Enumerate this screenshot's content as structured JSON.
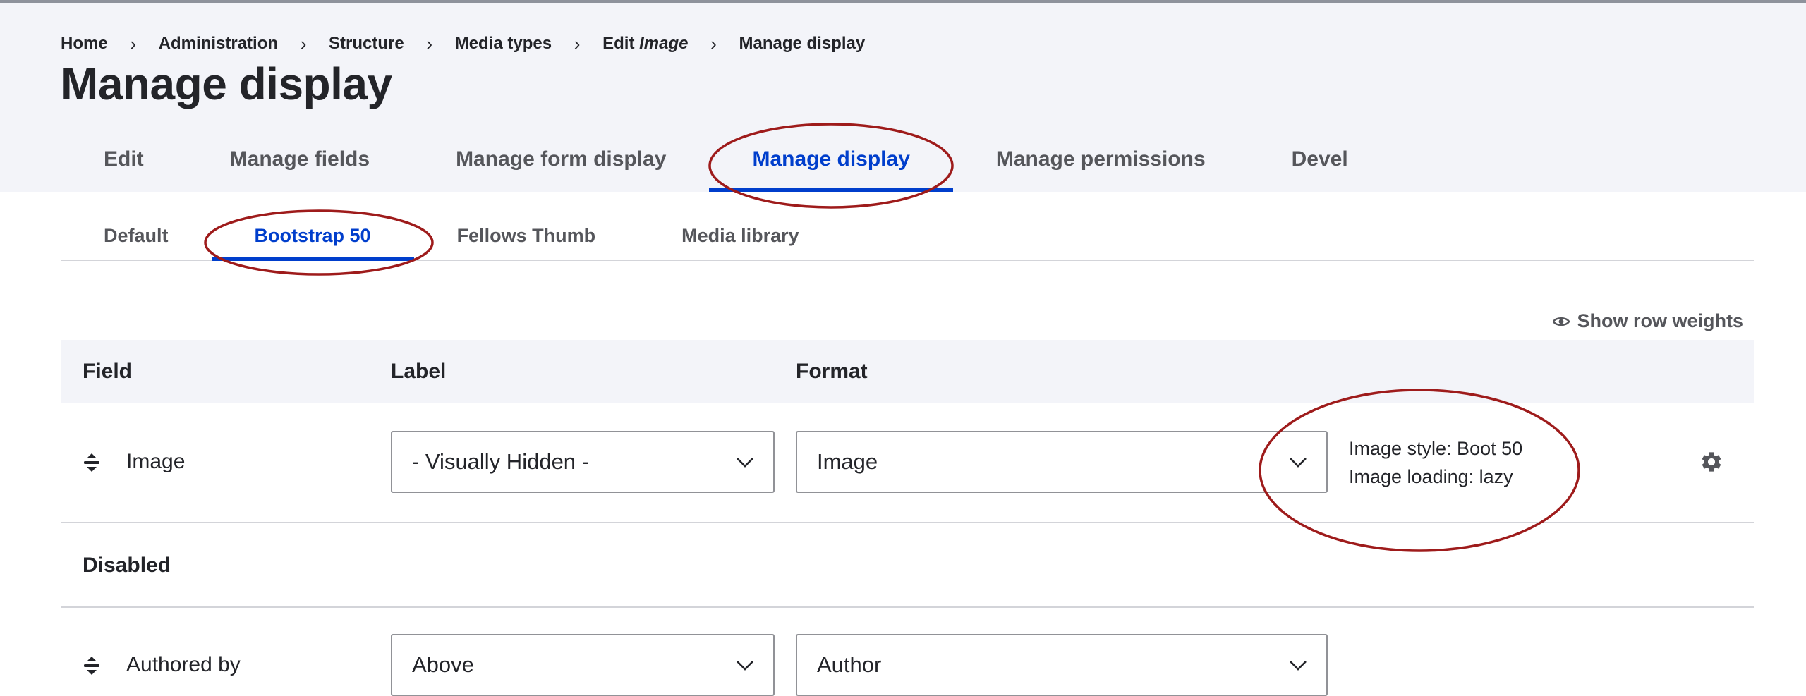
{
  "breadcrumb": [
    {
      "label": "Home"
    },
    {
      "label": "Administration"
    },
    {
      "label": "Structure"
    },
    {
      "label": "Media types"
    },
    {
      "label_prefix": "Edit ",
      "label_em": "Image"
    },
    {
      "label": "Manage display"
    }
  ],
  "breadcrumb_separator": "›",
  "page_title": "Manage display",
  "primary_tabs": [
    {
      "label": "Edit"
    },
    {
      "label": "Manage fields"
    },
    {
      "label": "Manage form display"
    },
    {
      "label": "Manage display",
      "active": true
    },
    {
      "label": "Manage permissions"
    },
    {
      "label": "Devel"
    }
  ],
  "secondary_tabs": [
    {
      "label": "Default"
    },
    {
      "label": "Bootstrap 50",
      "active": true
    },
    {
      "label": "Fellows Thumb"
    },
    {
      "label": "Media library"
    }
  ],
  "show_row_weights": "Show row weights",
  "table": {
    "headers": {
      "field": "Field",
      "label": "Label",
      "format": "Format"
    },
    "rows": [
      {
        "field": "Image",
        "label_select": "- Visually Hidden -",
        "format_select": "Image",
        "summary": [
          "Image style: Boot 50",
          "Image loading: lazy"
        ]
      }
    ],
    "disabled_title": "Disabled",
    "disabled_rows": [
      {
        "field": "Authored by",
        "label_select": "Above",
        "format_select": "Author"
      }
    ]
  },
  "icons": {
    "drag_handle": "drag-handle-icon",
    "chevron": "chevron-down-icon",
    "eye": "eye-icon",
    "gear": "gear-icon"
  },
  "colors": {
    "accent": "#003ecc",
    "header_bg": "#f3f4f9",
    "annotation": "#9e1b1b",
    "text": "#232429",
    "muted_text": "#55565b"
  }
}
